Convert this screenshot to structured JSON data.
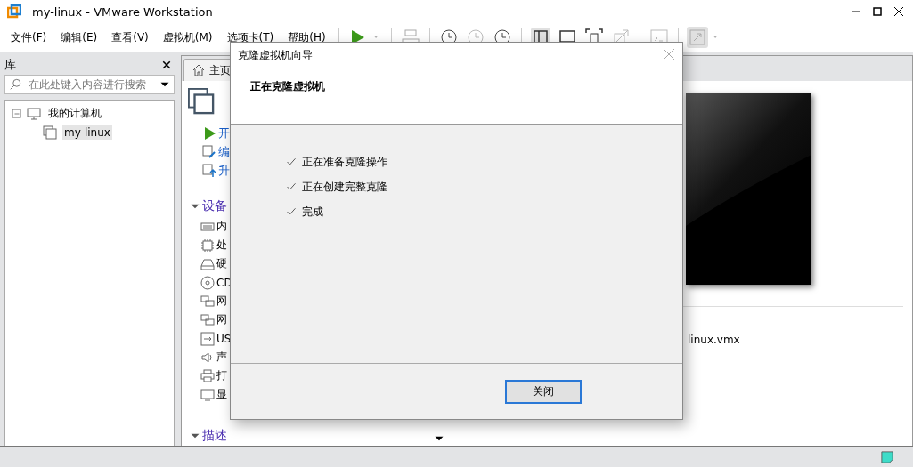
{
  "window": {
    "title": "my-linux - VMware Workstation"
  },
  "menu": [
    "文件(F)",
    "编辑(E)",
    "查看(V)",
    "虚拟机(M)",
    "选项卡(T)",
    "帮助(H)"
  ],
  "library": {
    "title": "库",
    "search": {
      "placeholder": "在此处键入内容进行搜索"
    },
    "tree": [
      {
        "label": "我的计算机",
        "expanded": true,
        "children": [
          {
            "label": "my-linux",
            "selected": true
          }
        ]
      }
    ]
  },
  "tabs": [
    {
      "label": "主页",
      "selected": false
    }
  ],
  "commands": [
    {
      "kind": "power",
      "label": "开"
    },
    {
      "kind": "edit",
      "label": "编"
    },
    {
      "kind": "upgrade",
      "label": "升"
    }
  ],
  "sections": [
    {
      "title": "设备",
      "expanded": true,
      "items": [
        {
          "kind": "memory",
          "label": "内"
        },
        {
          "kind": "cpu",
          "label": "处"
        },
        {
          "kind": "disk",
          "label": "硬"
        },
        {
          "kind": "cd",
          "label": "CD"
        },
        {
          "kind": "network",
          "label": "网"
        },
        {
          "kind": "network",
          "label": "网"
        },
        {
          "kind": "usb",
          "label": "US"
        },
        {
          "kind": "sound",
          "label": "声"
        },
        {
          "kind": "printer",
          "label": "打"
        },
        {
          "kind": "display",
          "label": "显"
        }
      ]
    },
    {
      "title": "描述",
      "expanded": true
    }
  ],
  "details": {
    "config_file": "linux.vmx"
  },
  "dialog": {
    "title": "克隆虚拟机向导",
    "heading": "正在克隆虚拟机",
    "steps": [
      {
        "label": "正在准备克隆操作",
        "done": true
      },
      {
        "label": "正在创建完整克隆",
        "done": true
      },
      {
        "label": "完成",
        "done": true
      }
    ],
    "button": "关闭"
  }
}
